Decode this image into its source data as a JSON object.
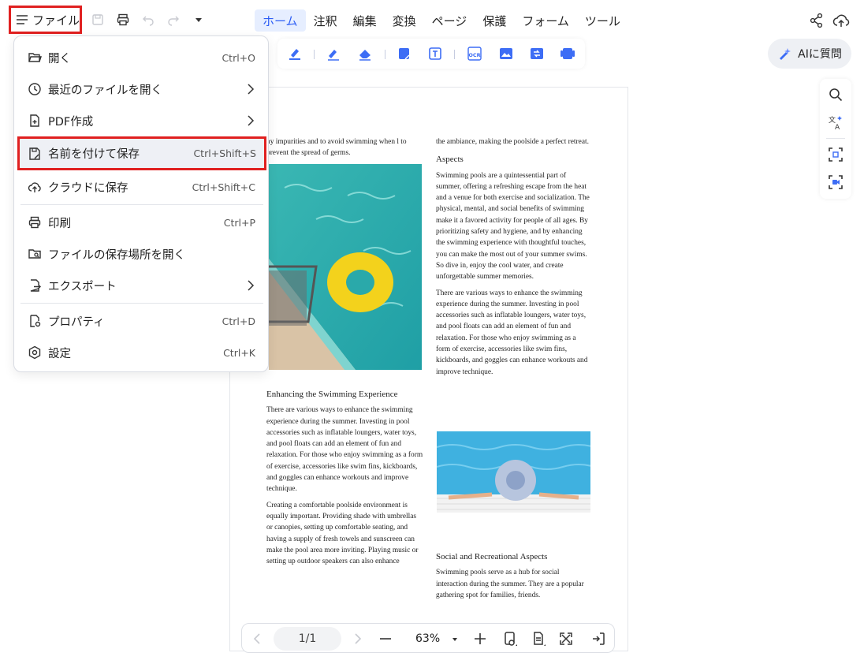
{
  "topbar": {
    "file_label": "ファイル",
    "tabs": [
      {
        "label": "ホーム",
        "active": true
      },
      {
        "label": "注釈",
        "active": false
      },
      {
        "label": "編集",
        "active": false
      },
      {
        "label": "変換",
        "active": false
      },
      {
        "label": "ページ",
        "active": false
      },
      {
        "label": "保護",
        "active": false
      },
      {
        "label": "フォーム",
        "active": false
      },
      {
        "label": "ツール",
        "active": false
      }
    ]
  },
  "ai_button": {
    "label": "AIに質問"
  },
  "file_menu": {
    "items": [
      {
        "label": "開く",
        "shortcut": "Ctrl+O",
        "icon": "folder-open-icon"
      },
      {
        "label": "最近のファイルを開く",
        "shortcut": "",
        "icon": "clock-icon",
        "submenu": true
      },
      {
        "label": "PDF作成",
        "shortcut": "",
        "icon": "file-plus-icon",
        "submenu": true
      },
      {
        "label": "名前を付けて保存",
        "shortcut": "Ctrl+Shift+S",
        "icon": "save-as-icon",
        "highlighted": true
      },
      {
        "label": "クラウドに保存",
        "shortcut": "Ctrl+Shift+C",
        "icon": "cloud-upload-icon"
      },
      {
        "label": "印刷",
        "shortcut": "Ctrl+P",
        "icon": "printer-icon"
      },
      {
        "label": "ファイルの保存場所を開く",
        "shortcut": "",
        "icon": "folder-search-icon"
      },
      {
        "label": "エクスポート",
        "shortcut": "",
        "icon": "export-icon",
        "submenu": true
      },
      {
        "label": "プロパティ",
        "shortcut": "Ctrl+D",
        "icon": "file-settings-icon"
      },
      {
        "label": "設定",
        "shortcut": "Ctrl+K",
        "icon": "settings-icon"
      }
    ]
  },
  "document": {
    "left_col": {
      "intro": "ny impurities and to avoid swimming when l to prevent the spread of germs.",
      "heading": "Enhancing the Swimming Experience",
      "p1": "There are various ways to enhance the swimming experience during the summer. Investing in pool accessories such as inflatable loungers, water toys, and pool floats can add an element of fun and relaxation. For those who enjoy swimming as a form of exercise, accessories like swim fins, kickboards, and goggles can enhance workouts and improve technique.",
      "p2": "Creating a comfortable poolside environment is equally important. Providing shade with umbrellas or canopies, setting up comfortable seating, and having a supply of fresh towels and sunscreen can make the pool area more inviting. Playing music or setting up outdoor speakers can also enhance"
    },
    "right_col": {
      "intro": "the ambiance, making the poolside a perfect retreat.",
      "heading1": "Aspects",
      "p1": "Swimming pools are a quintessential part of summer, offering a refreshing escape from the heat and a venue for both exercise and socialization. The physical, mental, and social benefits of swimming make it a favored activity for people of all ages. By prioritizing safety and hygiene, and by enhancing the swimming experience with thoughtful touches, you can make the most out of your summer swims. So dive in, enjoy the cool water, and create unforgettable summer memories.",
      "p2": "There are various ways to enhance the swimming experience during the summer. Investing in pool accessories such as inflatable loungers, water toys, and pool floats can add an element of fun and relaxation. For those who enjoy swimming as a form of exercise, accessories like swim fins, kickboards, and goggles can enhance workouts and improve technique.",
      "heading2": "Social and Recreational Aspects",
      "p3": "Swimming pools serve as a hub for social interaction during the summer. They are a popular gathering spot for families, friends."
    }
  },
  "bottombar": {
    "page_indicator": "1/1",
    "zoom": "63%"
  },
  "colors": {
    "accent": "#2d5ef5",
    "highlight_border": "#e02020",
    "icon_blue": "#3d6df5"
  }
}
